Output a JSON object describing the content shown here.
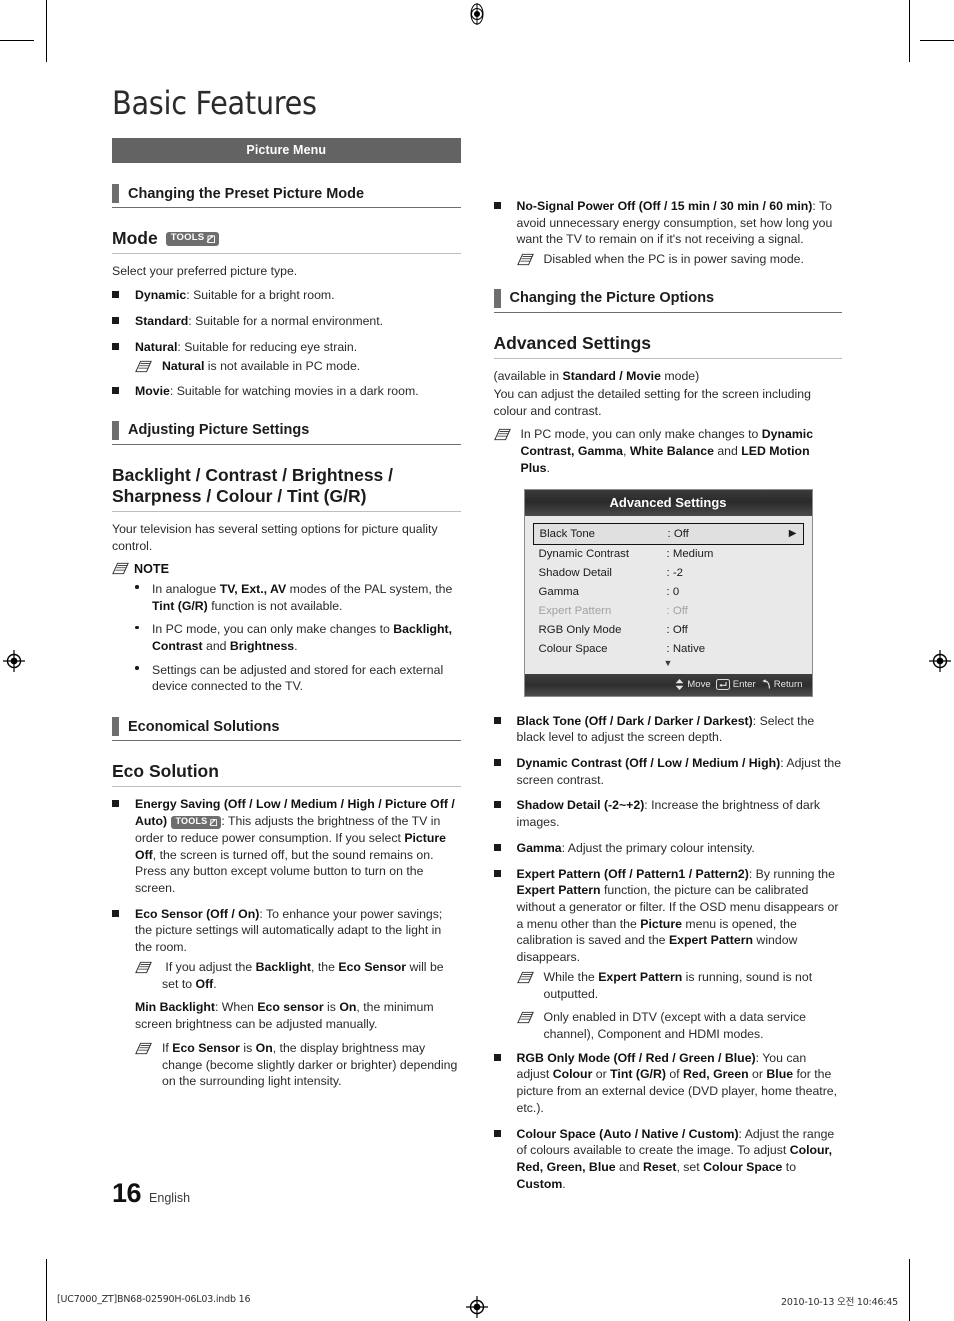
{
  "document": {
    "title": "Basic Features",
    "page_number": "16",
    "language": "English",
    "footer_left": "[UC7000_ZT]BN68-02590H-06L03.indb   16",
    "footer_right": "2010-10-13   오전 10:46:45",
    "accent_band_color": "#636363",
    "rule_color": "#6e6e6e"
  },
  "left_column": {
    "band": "Picture Menu",
    "section1": {
      "heading": "Changing the Preset Picture Mode"
    },
    "mode": {
      "heading": "Mode",
      "tools_badge": "TOOLS",
      "intro": "Select your preferred picture type.",
      "items": [
        {
          "term": "Dynamic",
          "rest": ": Suitable for a bright room."
        },
        {
          "term": "Standard",
          "rest": ": Suitable for a normal environment."
        },
        {
          "term": "Natural",
          "rest": ": Suitable for reducing eye strain."
        },
        {
          "term": "Movie",
          "rest": ": Suitable for watching movies in a dark room."
        }
      ],
      "natural_note": "is not available in PC mode.",
      "natural_note_term": "Natural"
    },
    "section2": {
      "heading": "Adjusting Picture Settings"
    },
    "backlight": {
      "heading": "Backlight / Contrast / Brightness / Sharpness / Colour / Tint (G/R)",
      "intro": "Your television has several setting options for picture quality control.",
      "note_label": "NOTE",
      "notes": [
        "In analogue TV, Ext., AV modes of the PAL system, the Tint (G/R) function is not available.",
        "In PC mode, you can only make changes to Backlight, Contrast and Brightness.",
        "Settings can be adjusted and stored for each external device connected to the TV."
      ]
    },
    "section3": {
      "heading": "Economical Solutions"
    },
    "eco": {
      "heading": "Eco Solution",
      "energy_saving_term": "Energy Saving (Off / Low / Medium / High / Picture Off / Auto)",
      "energy_saving_tools": "TOOLS",
      "energy_saving_body": ": This adjusts the brightness of the TV in order to reduce power consumption. If you select Picture Off, the screen is turned off, but the sound remains on. Press any button except volume button to turn on the screen.",
      "eco_sensor_term": "Eco Sensor (Off / On)",
      "eco_sensor_body": ": To enhance your power savings; the picture settings will automatically adapt to the light in the room.",
      "eco_sensor_note": "If you adjust the Backlight, the Eco Sensor will be set to Off.",
      "min_backlight_term": "Min Backlight",
      "min_backlight_body": ": When Eco sensor is On, the minimum screen brightness can be adjusted manually.",
      "min_backlight_note": "If Eco Sensor is On, the display brightness may change (become slightly darker or brighter) depending on the surrounding light intensity."
    }
  },
  "right_column": {
    "no_signal": {
      "term": "No-Signal Power Off (Off / 15 min / 30 min / 60 min)",
      "body": ": To avoid unnecessary energy consumption, set how long you want the TV to remain on if it's not receiving a signal.",
      "note": "Disabled when the PC is in power saving mode."
    },
    "section1": {
      "heading": "Changing the Picture Options"
    },
    "advanced": {
      "heading": "Advanced Settings",
      "available_prefix": "(available in ",
      "available_bold": "Standard / Movie",
      "available_suffix": " mode)",
      "body": "You can adjust the detailed setting for the screen including colour and contrast.",
      "note": "In PC mode, you can only make changes to Dynamic Contrast, Gamma, White Balance and LED Motion Plus."
    },
    "osd": {
      "title": "Advanced Settings",
      "rows": [
        {
          "label": "Black Tone",
          "value": ": Off",
          "selected": true,
          "dimmed": false,
          "arrow": "▶"
        },
        {
          "label": "Dynamic Contrast",
          "value": ": Medium",
          "selected": false,
          "dimmed": false,
          "arrow": ""
        },
        {
          "label": "Shadow Detail",
          "value": ": -2",
          "selected": false,
          "dimmed": false,
          "arrow": ""
        },
        {
          "label": "Gamma",
          "value": ": 0",
          "selected": false,
          "dimmed": false,
          "arrow": ""
        },
        {
          "label": "Expert Pattern",
          "value": ": Off",
          "selected": false,
          "dimmed": true,
          "arrow": ""
        },
        {
          "label": "RGB Only Mode",
          "value": ": Off",
          "selected": false,
          "dimmed": false,
          "arrow": ""
        },
        {
          "label": "Colour Space",
          "value": ": Native",
          "selected": false,
          "dimmed": false,
          "arrow": ""
        }
      ],
      "scroll_indicator": "▼",
      "footer": {
        "move": "Move",
        "enter": "Enter",
        "return": "Return"
      }
    },
    "options": [
      {
        "term": "Black Tone (Off / Dark / Darker / Darkest)",
        "body": ": Select the black level to adjust the screen depth."
      },
      {
        "term": "Dynamic Contrast (Off / Low / Medium / High)",
        "body": ": Adjust the screen contrast."
      },
      {
        "term": "Shadow Detail (-2~+2)",
        "body": ": Increase the brightness of dark images."
      },
      {
        "term": "Gamma",
        "body": ": Adjust the primary colour intensity."
      },
      {
        "term": "Expert Pattern (Off / Pattern1 / Pattern2)",
        "body": ": By running the Expert Pattern function, the picture can be calibrated without a generator or filter. If the OSD menu disappears or a menu other than the Picture menu is opened, the calibration is saved and the Expert Pattern window disappears."
      },
      {
        "term": "RGB Only Mode (Off / Red / Green / Blue)",
        "body": ": You can adjust Colour or Tint (G/R) of Red, Green or Blue for the picture from an external device (DVD player, home theatre, etc.)."
      },
      {
        "term": "Colour Space (Auto / Native / Custom)",
        "body": ": Adjust the range of colours available to create the image. To adjust Colour, Red, Green, Blue and Reset, set Colour Space to Custom."
      }
    ],
    "expert_notes": [
      "While the Expert Pattern is running, sound is not outputted.",
      "Only enabled in DTV (except with a data service channel), Component and HDMI modes."
    ]
  }
}
